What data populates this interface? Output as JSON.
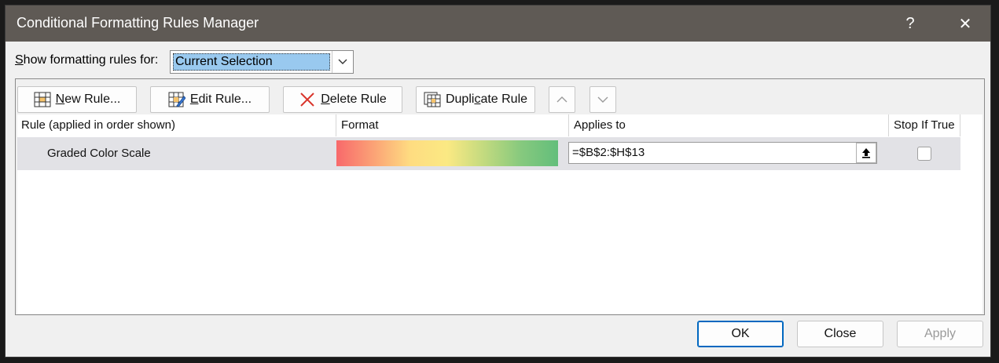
{
  "window": {
    "title": "Conditional Formatting Rules Manager",
    "help_glyph": "?",
    "close_glyph": "✕"
  },
  "show_for": {
    "label_mnemonic": "S",
    "label_rest": "how formatting rules for:",
    "selected": "Current Selection"
  },
  "toolbar": {
    "new_rule": {
      "mnemonic": "N",
      "rest": "ew Rule..."
    },
    "edit_rule": {
      "mnemonic": "E",
      "rest": "dit Rule..."
    },
    "delete_rule": {
      "mnemonic": "D",
      "rest": "elete Rule"
    },
    "duplicate_rule": {
      "pre": "Dupli",
      "mnemonic": "c",
      "rest": "ate Rule"
    }
  },
  "columns": [
    "Rule (applied in order shown)",
    "Format",
    "Applies to",
    "Stop If True"
  ],
  "rules": [
    {
      "name": "Graded Color Scale",
      "format_colors": [
        "#f8696b",
        "#fedc81",
        "#63be7b"
      ],
      "applies_to": "=$B$2:$H$13",
      "stop_if_true": false
    }
  ],
  "footer": {
    "ok": "OK",
    "close": "Close",
    "apply": "Apply"
  }
}
